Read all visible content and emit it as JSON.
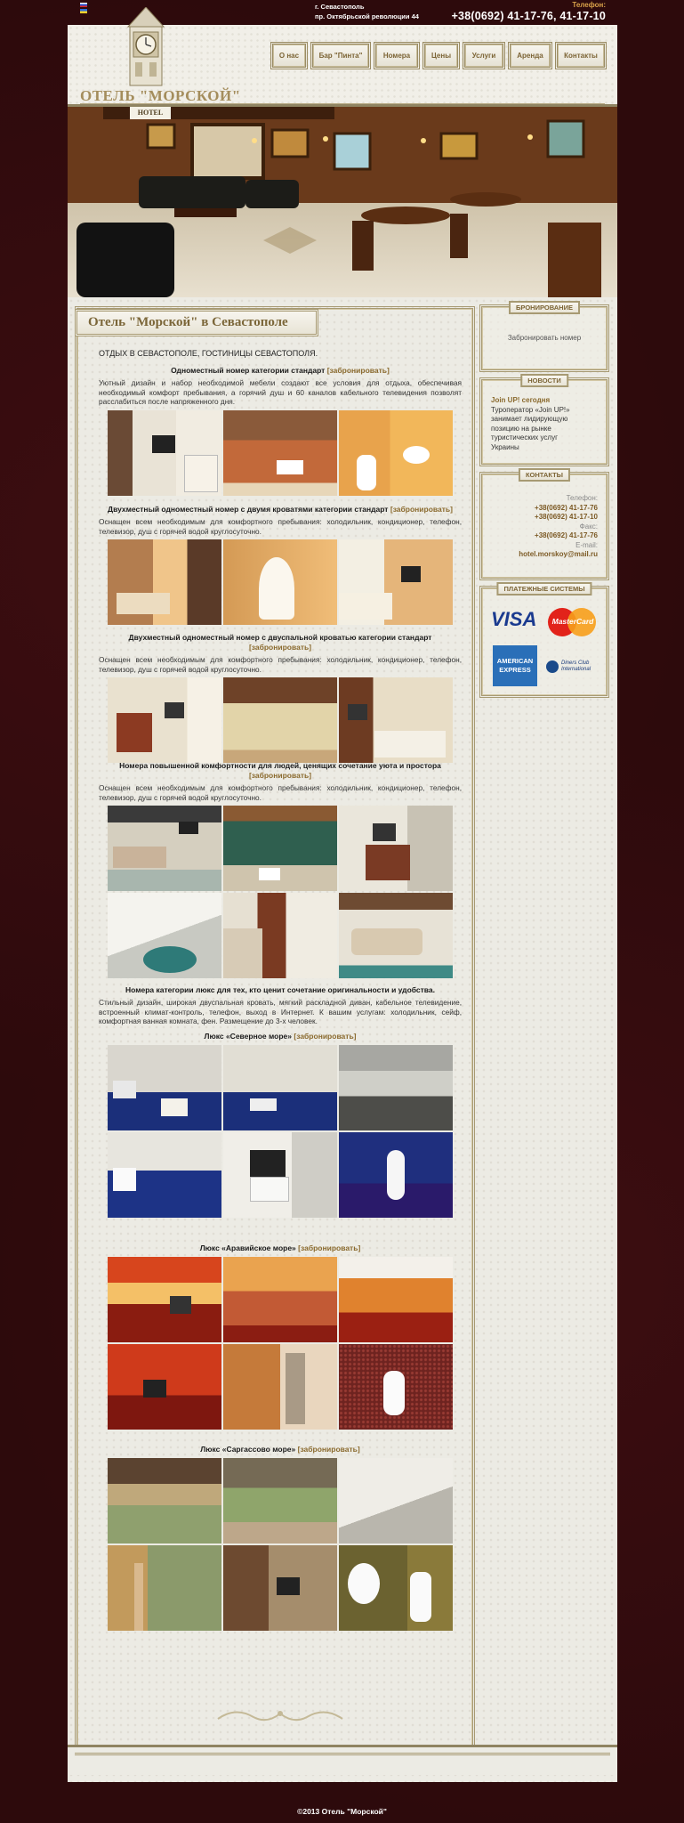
{
  "header": {
    "address_city": "г. Севастополь",
    "address_street": "пр. Октябрьской революции 44",
    "phone_label": "Телефон:",
    "phone": "+38(0692) 41-17-76, 41-17-10",
    "logo": "ОТЕЛЬ \"МОРСКОЙ\"",
    "banner_sign": "HOTEL"
  },
  "nav": [
    "О нас",
    "Бар \"Пинта\"",
    "Номера",
    "Цены",
    "Услуги",
    "Аренда",
    "Контакты"
  ],
  "page": {
    "title": "Отель \"Морской\" в Севастополе",
    "intro": "ОТДЫХ В СЕВАСТОПОЛЕ, ГОСТИНИЦЫ СЕВАСТОПОЛЯ.",
    "book": "[забронировать]"
  },
  "sections": [
    {
      "title": "Одноместный номер категории стандарт",
      "desc": "Уютный дизайн и набор необходимой мебели создают все условия для отдыха, обеспечивая необходимый комфорт пребывания, а горячий душ и 60 каналов кабельного телевидения позволят расслабиться после напряженного дня."
    },
    {
      "title": "Двухместный одноместный номер с двумя кроватями категории стандарт",
      "desc": "Оснащен всем необходимым для комфортного пребывания: холодильник, кондиционер, телефон, телевизор, душ с горячей водой круглосуточно."
    },
    {
      "title": "Двухместный одноместный номер с двуспальной кроватью категории стандарт",
      "desc": "Оснащен всем необходимым для комфортного пребывания: холодильник, кондиционер, телефон, телевизор, душ с горячей водой круглосуточно."
    },
    {
      "title": "Номера повышенной комфортности для людей, ценящих сочетание уюта и простора",
      "desc": "Оснащен всем необходимым для комфортного пребывания: холодильник, кондиционер, телефон, телевизор, душ с горячей водой круглосуточно."
    },
    {
      "title": "Номера категории люкс для тех, кто ценит сочетание оригинальности и удобства.",
      "desc": "Стильный дизайн, широкая двуспальная кровать, мягкий раскладной диван, кабельное телевидение, встроенный климат-контроль, телефон, выход в Интернет. К вашим услугам: холодильник, сейф, комфортная ванная комната, фен. Размещение до 3-х человек."
    },
    {
      "title": "Люкс «Северное море»"
    },
    {
      "title": "Люкс «Аравийское море»"
    },
    {
      "title": "Люкс «Саргассово море»"
    }
  ],
  "sidebar": {
    "booking_head": "БРОНИРОВАНИЕ",
    "booking_link": "Забронировать номер",
    "news_head": "НОВОСТИ",
    "news_title": "Join UP! сегодня",
    "news_text": "Туроператор «Join UP!» занимает лидирующую позицию на рынке туристических услуг Украины",
    "contacts_head": "КОНТАКТЫ",
    "tel_label": "Телефон:",
    "tel1": "+38(0692) 41-17-76",
    "tel2": "+38(0692) 41-17-10",
    "fax_label": "Факс:",
    "fax": "+38(0692) 41-17-76",
    "email_label": "E-mail:",
    "email": "hotel.morskoy@mail.ru",
    "payment_head": "ПЛАТЕЖНЫЕ СИСТЕМЫ",
    "visa": "VISA",
    "mastercard": "MasterCard",
    "amex1": "AMERICAN",
    "amex2": "EXPRESS",
    "diners": "Diners Club International"
  },
  "footer": {
    "copyright": "©2013 Отель \"Морской\""
  }
}
